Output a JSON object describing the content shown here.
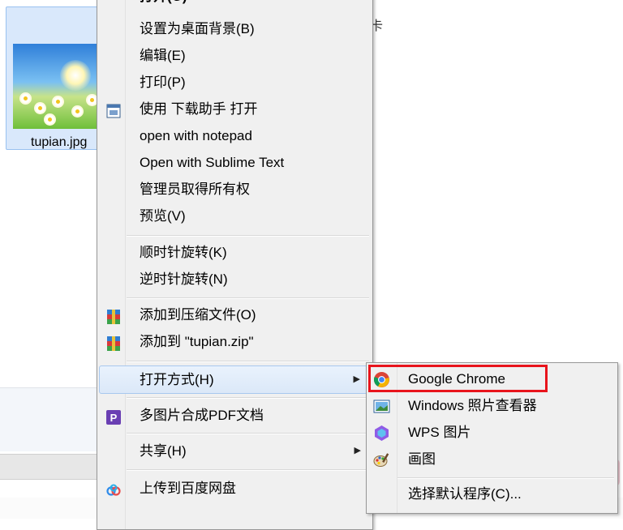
{
  "file": {
    "name": "tupian.jpg"
  },
  "background": {
    "partial_text": "卡"
  },
  "menu": {
    "items": [
      {
        "label": "打开(O)",
        "bold": true
      },
      {
        "label": "设置为桌面背景(B)"
      },
      {
        "label": "编辑(E)"
      },
      {
        "label": "打印(P)"
      },
      {
        "label": "使用 下载助手 打开",
        "icon": "download-assistant-icon"
      },
      {
        "label": "open with notepad"
      },
      {
        "label": "Open with Sublime Text"
      },
      {
        "label": "管理员取得所有权"
      },
      {
        "label": "预览(V)"
      },
      {
        "label": "顺时针旋转(K)"
      },
      {
        "label": "逆时针旋转(N)"
      },
      {
        "label": "添加到压缩文件(O)",
        "icon": "winrar-archive-icon"
      },
      {
        "label": "添加到 \"tupian.zip\"",
        "icon": "winrar-archive-icon"
      },
      {
        "label": "打开方式(H)",
        "has_submenu": true
      },
      {
        "label": "多图片合成PDF文档",
        "icon": "pdf-merge-icon"
      },
      {
        "label": "共享(H)",
        "has_submenu": true
      },
      {
        "label": "上传到百度网盘",
        "icon": "baidu-netdisk-icon"
      }
    ]
  },
  "submenu": {
    "items": [
      {
        "label": "Google Chrome",
        "icon": "chrome-icon",
        "highlighted": true
      },
      {
        "label": "Windows 照片查看器",
        "icon": "photo-viewer-icon"
      },
      {
        "label": "WPS 图片",
        "icon": "wps-image-icon"
      },
      {
        "label": "画图",
        "icon": "paint-icon"
      },
      {
        "label": "选择默认程序(C)..."
      }
    ]
  },
  "colors": {
    "highlight": "#e8141c",
    "menu_bg": "#f0f0f0",
    "selection": "#d9e8fb"
  }
}
